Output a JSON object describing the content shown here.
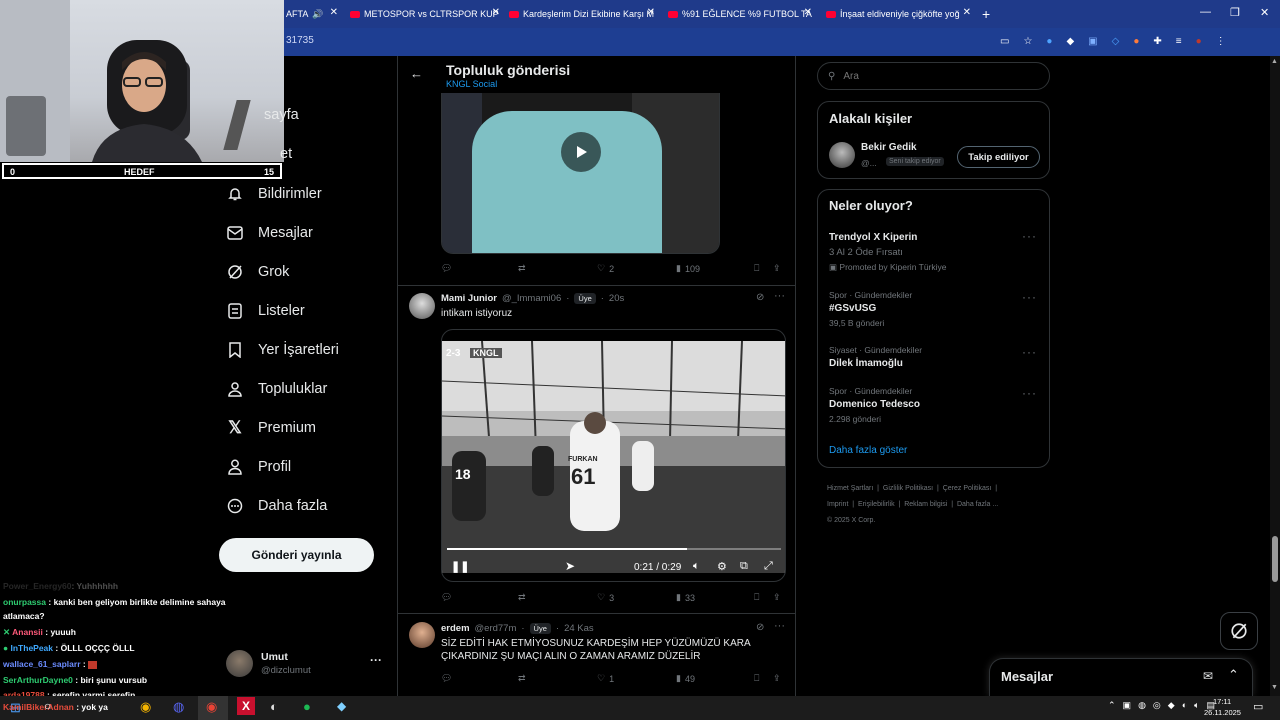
{
  "browser": {
    "tabs": [
      {
        "label": "AFTA"
      },
      {
        "label": "METOSPOR vs CLTRSPOR KUP"
      },
      {
        "label": "Kardeşlerim Dizi Ekibine Karşı M"
      },
      {
        "label": "%91 EĞLENCE %9 FUTBOL TAD"
      },
      {
        "label": "İnşaat eldiveniyle çiğköfte yoğ"
      }
    ],
    "new_tab": "+",
    "url_fragment": "31735"
  },
  "stream": {
    "hedef_left": "0",
    "hedef_label": "HEDEF",
    "hedef_right": "15"
  },
  "nav": {
    "items": [
      {
        "label": "sayfa"
      },
      {
        "label": "et"
      },
      {
        "label": "Bildirimler"
      },
      {
        "label": "Mesajlar"
      },
      {
        "label": "Grok"
      },
      {
        "label": "Listeler"
      },
      {
        "label": "Yer İşaretleri"
      },
      {
        "label": "Topluluklar"
      },
      {
        "label": "Premium"
      },
      {
        "label": "Profil"
      },
      {
        "label": "Daha fazla"
      }
    ],
    "post_button": "Gönderi yayınla",
    "account_name": "Umut",
    "account_handle": "@dizclumut"
  },
  "chat": [
    {
      "user": "Power_Energy60",
      "text": ": Yuhhhhhh",
      "color": "#555555"
    },
    {
      "user": "onurpassa",
      "text": ": kanki ben geliyom birlikte delimine sahaya",
      "color": "#2ecc71"
    },
    {
      "user": "",
      "text": "atlamaca?",
      "color": "#ffffff"
    },
    {
      "user": "Anansii",
      "text": ": yuuuh",
      "color": "#ff5a7a"
    },
    {
      "user": "InThePeak",
      "text": ": ÖLLL OÇÇÇ ÖLLL",
      "color": "#3fa9ff"
    },
    {
      "user": "wallace_61_saplarr",
      "text": ":",
      "color": "#6b8cff"
    },
    {
      "user": "SerArthurDayne0",
      "text": ": biri şunu vursub",
      "color": "#2ecc71"
    },
    {
      "user": "arda19788",
      "text": ": şerefin varmi şerefin",
      "color": "#e74c3c"
    },
    {
      "user": "KamilBikerAdnan",
      "text": ": yok ya",
      "color": "#e74c3c"
    }
  ],
  "header": {
    "title": "Topluluk gönderisi",
    "subtitle": "KNGL Social"
  },
  "post1": {
    "replies": "",
    "reposts": "",
    "likes": "2",
    "views": "109"
  },
  "post2": {
    "name": "Mami Junior",
    "handle": "@_Immami06",
    "badge": "Üye",
    "time": "20s",
    "text": "intikam istiyoruz",
    "score": "2-3",
    "brand": "KNGL",
    "jersey_name": "FURKAN",
    "jersey_number": "61",
    "player_left_number": "18",
    "time_display": "0:21 / 0:29",
    "progress": 0.72,
    "likes": "3",
    "views": "33"
  },
  "post3": {
    "name": "erdem",
    "handle": "@erd77m",
    "badge": "Üye",
    "time": "24 Kas",
    "text": "SİZ EDİTİ HAK ETMİYOSUNUZ KARDEŞİM HEP YÜZÜMÜZÜ KARA ÇIKARDINIZ ŞU MAÇI ALIN O ZAMAN ARAMIZ DÜZELİR",
    "likes": "1",
    "views": "49"
  },
  "search": {
    "placeholder": "Ara"
  },
  "related": {
    "title": "Alakalı kişiler",
    "name": "Bekir Gedik",
    "handle": "@...",
    "follows_you": "Seni takip ediyor",
    "follow_button": "Takip ediliyor"
  },
  "trends": {
    "title": "Neler oluyor?",
    "promo_title": "Trendyol X Kiperin",
    "promo_text": "3 Al 2 Öde Fırsatı",
    "promo_by": "Promoted by Kiperin Türkiye",
    "items": [
      {
        "context": "Spor · Gündemdekiler",
        "name": "#GSvUSG",
        "count": "39,5 B gönderi"
      },
      {
        "context": "Siyaset · Gündemdekiler",
        "name": "Dilek İmamoğlu",
        "count": ""
      },
      {
        "context": "Spor · Gündemdekiler",
        "name": "Domenico Tedesco",
        "count": "2.298 gönderi"
      }
    ],
    "show_more": "Daha fazla göster"
  },
  "footer": {
    "links": [
      "Hizmet Şartları",
      "Gizlilik Politikası",
      "Çerez Politikası",
      "Imprint",
      "Erişilebilirlik",
      "Reklam bilgisi",
      "Daha fazla ..."
    ],
    "copyright": "© 2025 X Corp."
  },
  "messages_bar": {
    "label": "Mesajlar"
  },
  "taskbar": {
    "time": "17:11",
    "date": "26.11.2025"
  },
  "colors": {
    "accent": "#1d9bf0",
    "background": "#000000",
    "border": "#2f3336",
    "muted": "#71767b"
  }
}
